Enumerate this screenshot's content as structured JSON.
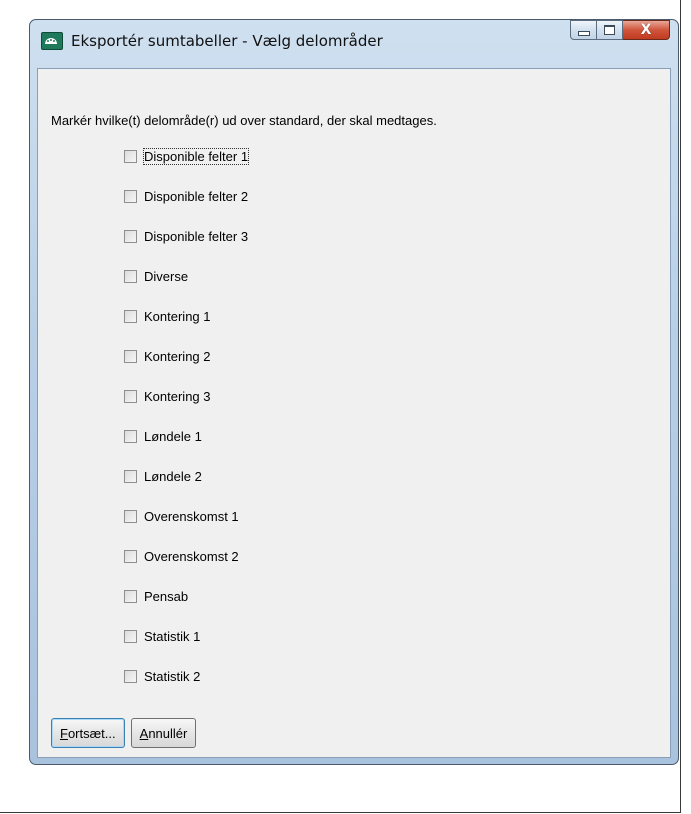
{
  "window": {
    "title": "Eksportér sumtabeller - Vælg delområder",
    "close_glyph": "X"
  },
  "dialog": {
    "instruction": "Markér hvilke(t) delområde(r) ud over standard, der skal medtages.",
    "options": [
      {
        "label": "Disponible felter 1",
        "checked": false
      },
      {
        "label": "Disponible felter 2",
        "checked": false
      },
      {
        "label": "Disponible felter 3",
        "checked": false
      },
      {
        "label": "Diverse",
        "checked": false
      },
      {
        "label": "Kontering 1",
        "checked": false
      },
      {
        "label": "Kontering 2",
        "checked": false
      },
      {
        "label": "Kontering 3",
        "checked": false
      },
      {
        "label": "Løndele 1",
        "checked": false
      },
      {
        "label": "Løndele 2",
        "checked": false
      },
      {
        "label": "Overenskomst 1",
        "checked": false
      },
      {
        "label": "Overenskomst 2",
        "checked": false
      },
      {
        "label": "Pensab",
        "checked": false
      },
      {
        "label": "Statistik 1",
        "checked": false
      },
      {
        "label": "Statistik 2",
        "checked": false
      }
    ],
    "buttons": {
      "continue_mnemonic": "F",
      "continue_rest": "ortsæt...",
      "cancel_mnemonic": "A",
      "cancel_rest": "nnullér"
    }
  }
}
